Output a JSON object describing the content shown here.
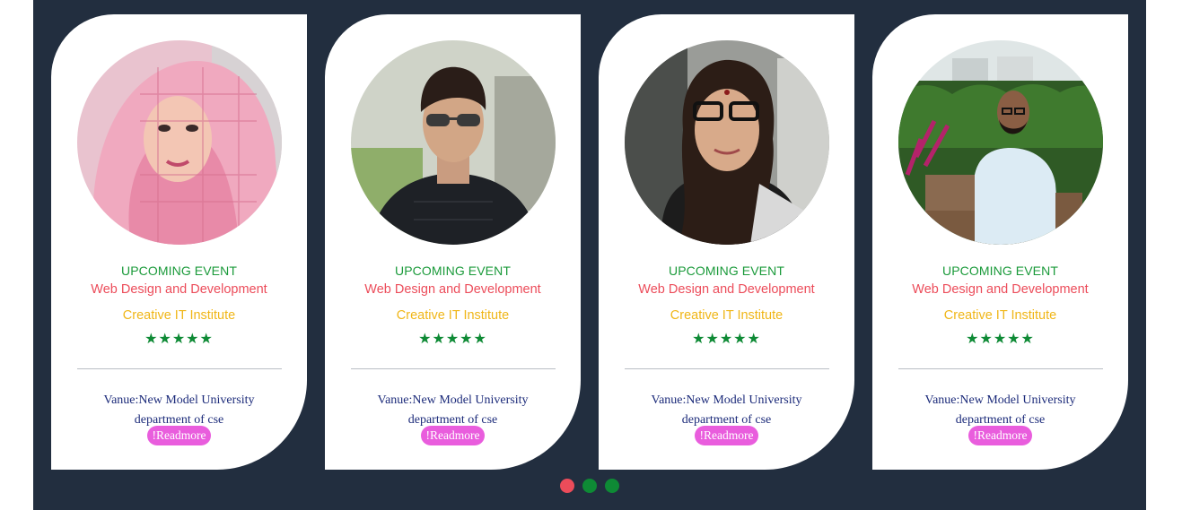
{
  "colors": {
    "background": "#222e3f",
    "card": "#ffffff",
    "upcoming": "#1a9a3a",
    "course": "#ec4c5a",
    "institute": "#f0b617",
    "stars": "#0e8a35",
    "venue": "#1c2b7a",
    "readmore_bg": "#e95ddd",
    "dot_active": "#ec4c5a",
    "dot_inactive": "#0e8a35"
  },
  "cards": [
    {
      "photo": "woman-in-pink-hijab-photo",
      "upcoming": "UPCOMING EVENT",
      "course": "Web Design and Development",
      "institute": "Creative IT Institute",
      "stars": "★★★★★",
      "venue_line1": "Vanue:New Model University",
      "venue_line2": "department of cse",
      "readmore": "!Readmore"
    },
    {
      "photo": "young-man-with-sunglasses-photo",
      "upcoming": "UPCOMING EVENT",
      "course": "Web Design and Development",
      "institute": "Creative IT Institute",
      "stars": "★★★★★",
      "venue_line1": "Vanue:New Model University",
      "venue_line2": "department of cse",
      "readmore": "!Readmore"
    },
    {
      "photo": "woman-with-glasses-photo",
      "upcoming": "UPCOMING EVENT",
      "course": "Web Design and Development",
      "institute": "Creative IT Institute",
      "stars": "★★★★★",
      "venue_line1": "Vanue:New Model University",
      "venue_line2": "department of cse",
      "readmore": "!Readmore"
    },
    {
      "photo": "man-sitting-in-garden-photo",
      "upcoming": "UPCOMING EVENT",
      "course": "Web Design and Development",
      "institute": "Creative IT Institute",
      "stars": "★★★★★",
      "venue_line1": "Vanue:New Model University",
      "venue_line2": "department of cse",
      "readmore": "!Readmore"
    }
  ],
  "carousel": {
    "active_index": 0,
    "dot_count": 3
  }
}
